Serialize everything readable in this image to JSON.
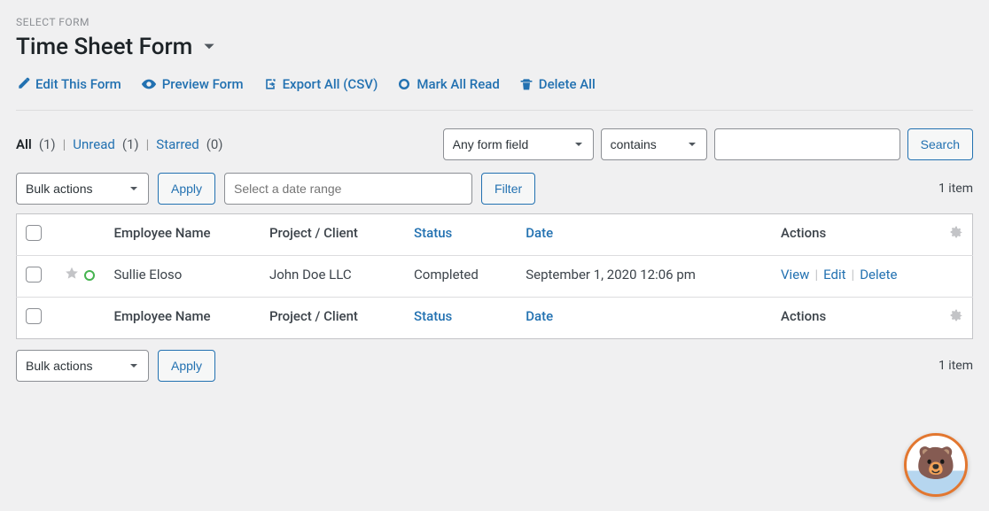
{
  "header": {
    "section_label": "SELECT FORM",
    "title": "Time Sheet Form"
  },
  "action_links": {
    "edit": "Edit This Form",
    "preview": "Preview Form",
    "export": "Export All (CSV)",
    "mark_read": "Mark All Read",
    "delete_all": "Delete All"
  },
  "filters": {
    "all_label": "All",
    "all_count": "(1)",
    "unread_label": "Unread",
    "unread_count": "(1)",
    "starred_label": "Starred",
    "starred_count": "(0)"
  },
  "search": {
    "field_option": "Any form field",
    "operator_option": "contains",
    "value": "",
    "button": "Search"
  },
  "bulk": {
    "select_label": "Bulk actions",
    "apply": "Apply",
    "date_placeholder": "Select a date range",
    "filter": "Filter"
  },
  "item_count": "1 item",
  "columns": {
    "employee": "Employee Name",
    "project": "Project / Client",
    "status": "Status",
    "date": "Date",
    "actions": "Actions"
  },
  "rows": [
    {
      "employee": "Sullie Eloso",
      "project": "John Doe LLC",
      "status": "Completed",
      "date": "September 1, 2020 12:06 pm",
      "actions": {
        "view": "View",
        "edit": "Edit",
        "delete": "Delete"
      }
    }
  ],
  "mascot_emoji": "🐻",
  "colors": {
    "link": "#2271b1",
    "accent_green": "#46b450",
    "mascot_border": "#e27730"
  }
}
